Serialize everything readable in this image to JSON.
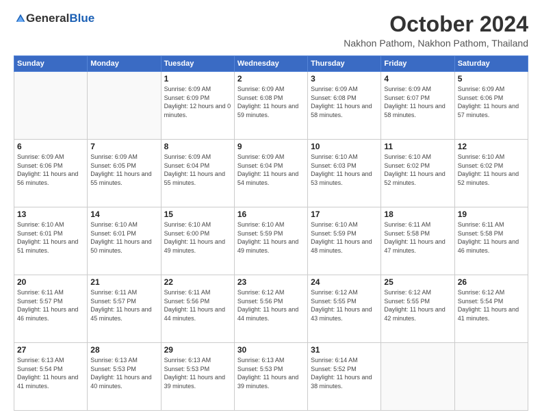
{
  "logo": {
    "general": "General",
    "blue": "Blue"
  },
  "header": {
    "month": "October 2024",
    "location": "Nakhon Pathom, Nakhon Pathom, Thailand"
  },
  "days_of_week": [
    "Sunday",
    "Monday",
    "Tuesday",
    "Wednesday",
    "Thursday",
    "Friday",
    "Saturday"
  ],
  "weeks": [
    [
      {
        "day": "",
        "info": ""
      },
      {
        "day": "",
        "info": ""
      },
      {
        "day": "1",
        "info": "Sunrise: 6:09 AM\nSunset: 6:09 PM\nDaylight: 12 hours\nand 0 minutes."
      },
      {
        "day": "2",
        "info": "Sunrise: 6:09 AM\nSunset: 6:08 PM\nDaylight: 11 hours\nand 59 minutes."
      },
      {
        "day": "3",
        "info": "Sunrise: 6:09 AM\nSunset: 6:08 PM\nDaylight: 11 hours\nand 58 minutes."
      },
      {
        "day": "4",
        "info": "Sunrise: 6:09 AM\nSunset: 6:07 PM\nDaylight: 11 hours\nand 58 minutes."
      },
      {
        "day": "5",
        "info": "Sunrise: 6:09 AM\nSunset: 6:06 PM\nDaylight: 11 hours\nand 57 minutes."
      }
    ],
    [
      {
        "day": "6",
        "info": "Sunrise: 6:09 AM\nSunset: 6:06 PM\nDaylight: 11 hours\nand 56 minutes."
      },
      {
        "day": "7",
        "info": "Sunrise: 6:09 AM\nSunset: 6:05 PM\nDaylight: 11 hours\nand 55 minutes."
      },
      {
        "day": "8",
        "info": "Sunrise: 6:09 AM\nSunset: 6:04 PM\nDaylight: 11 hours\nand 55 minutes."
      },
      {
        "day": "9",
        "info": "Sunrise: 6:09 AM\nSunset: 6:04 PM\nDaylight: 11 hours\nand 54 minutes."
      },
      {
        "day": "10",
        "info": "Sunrise: 6:10 AM\nSunset: 6:03 PM\nDaylight: 11 hours\nand 53 minutes."
      },
      {
        "day": "11",
        "info": "Sunrise: 6:10 AM\nSunset: 6:02 PM\nDaylight: 11 hours\nand 52 minutes."
      },
      {
        "day": "12",
        "info": "Sunrise: 6:10 AM\nSunset: 6:02 PM\nDaylight: 11 hours\nand 52 minutes."
      }
    ],
    [
      {
        "day": "13",
        "info": "Sunrise: 6:10 AM\nSunset: 6:01 PM\nDaylight: 11 hours\nand 51 minutes."
      },
      {
        "day": "14",
        "info": "Sunrise: 6:10 AM\nSunset: 6:01 PM\nDaylight: 11 hours\nand 50 minutes."
      },
      {
        "day": "15",
        "info": "Sunrise: 6:10 AM\nSunset: 6:00 PM\nDaylight: 11 hours\nand 49 minutes."
      },
      {
        "day": "16",
        "info": "Sunrise: 6:10 AM\nSunset: 5:59 PM\nDaylight: 11 hours\nand 49 minutes."
      },
      {
        "day": "17",
        "info": "Sunrise: 6:10 AM\nSunset: 5:59 PM\nDaylight: 11 hours\nand 48 minutes."
      },
      {
        "day": "18",
        "info": "Sunrise: 6:11 AM\nSunset: 5:58 PM\nDaylight: 11 hours\nand 47 minutes."
      },
      {
        "day": "19",
        "info": "Sunrise: 6:11 AM\nSunset: 5:58 PM\nDaylight: 11 hours\nand 46 minutes."
      }
    ],
    [
      {
        "day": "20",
        "info": "Sunrise: 6:11 AM\nSunset: 5:57 PM\nDaylight: 11 hours\nand 46 minutes."
      },
      {
        "day": "21",
        "info": "Sunrise: 6:11 AM\nSunset: 5:57 PM\nDaylight: 11 hours\nand 45 minutes."
      },
      {
        "day": "22",
        "info": "Sunrise: 6:11 AM\nSunset: 5:56 PM\nDaylight: 11 hours\nand 44 minutes."
      },
      {
        "day": "23",
        "info": "Sunrise: 6:12 AM\nSunset: 5:56 PM\nDaylight: 11 hours\nand 44 minutes."
      },
      {
        "day": "24",
        "info": "Sunrise: 6:12 AM\nSunset: 5:55 PM\nDaylight: 11 hours\nand 43 minutes."
      },
      {
        "day": "25",
        "info": "Sunrise: 6:12 AM\nSunset: 5:55 PM\nDaylight: 11 hours\nand 42 minutes."
      },
      {
        "day": "26",
        "info": "Sunrise: 6:12 AM\nSunset: 5:54 PM\nDaylight: 11 hours\nand 41 minutes."
      }
    ],
    [
      {
        "day": "27",
        "info": "Sunrise: 6:13 AM\nSunset: 5:54 PM\nDaylight: 11 hours\nand 41 minutes."
      },
      {
        "day": "28",
        "info": "Sunrise: 6:13 AM\nSunset: 5:53 PM\nDaylight: 11 hours\nand 40 minutes."
      },
      {
        "day": "29",
        "info": "Sunrise: 6:13 AM\nSunset: 5:53 PM\nDaylight: 11 hours\nand 39 minutes."
      },
      {
        "day": "30",
        "info": "Sunrise: 6:13 AM\nSunset: 5:53 PM\nDaylight: 11 hours\nand 39 minutes."
      },
      {
        "day": "31",
        "info": "Sunrise: 6:14 AM\nSunset: 5:52 PM\nDaylight: 11 hours\nand 38 minutes."
      },
      {
        "day": "",
        "info": ""
      },
      {
        "day": "",
        "info": ""
      }
    ]
  ]
}
